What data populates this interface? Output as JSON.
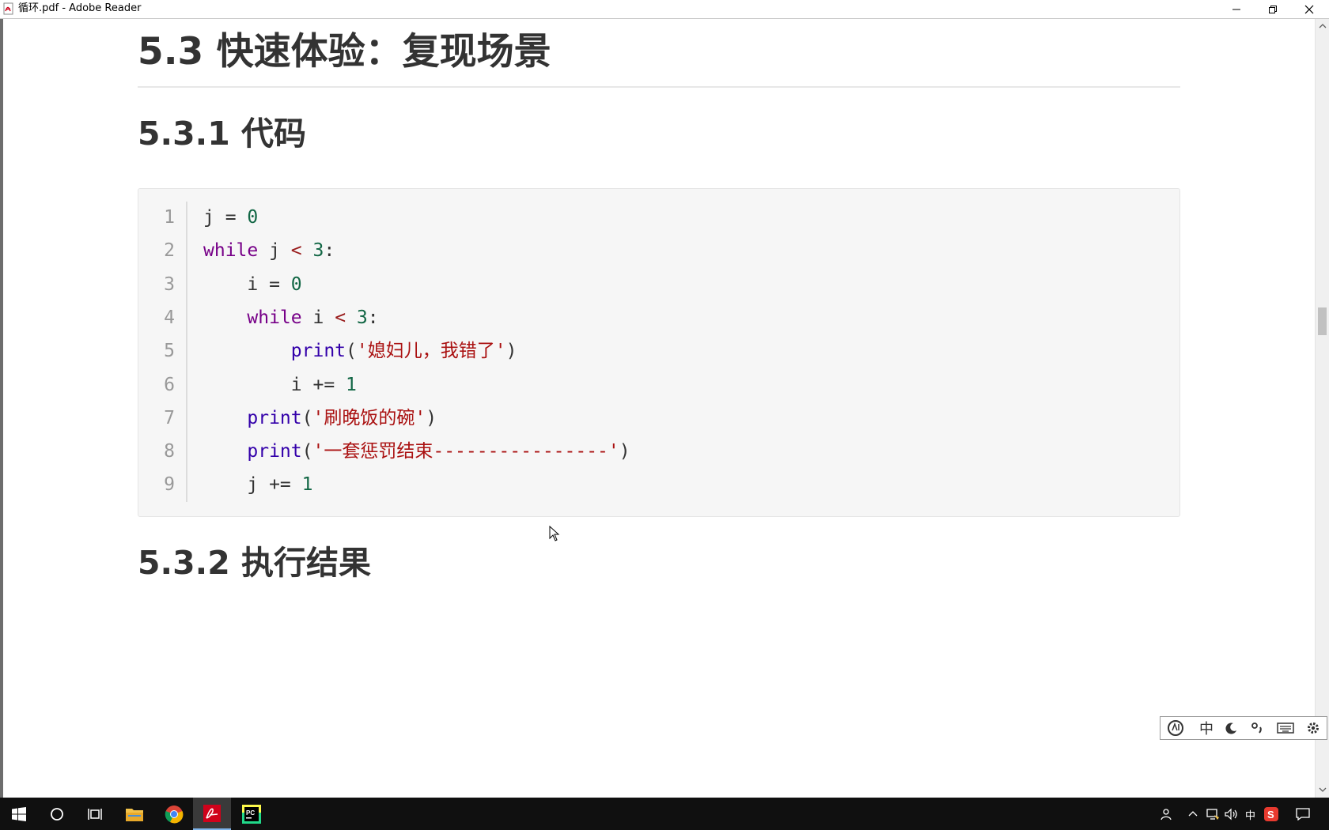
{
  "window": {
    "title": "循环.pdf - Adobe Reader",
    "controls": [
      "minimize-icon",
      "restore-icon",
      "close-icon"
    ]
  },
  "document": {
    "heading_h2": "5.3 快速体验：复现场景",
    "heading_code": "5.3.1 代码",
    "heading_result": "5.3.2 执行结果",
    "code": {
      "line_numbers": [
        "1",
        "2",
        "3",
        "4",
        "5",
        "6",
        "7",
        "8",
        "9"
      ],
      "lines": [
        [
          {
            "t": "j ",
            "c": ""
          },
          {
            "t": "=",
            "c": ""
          },
          {
            "t": " ",
            "c": ""
          },
          {
            "t": "0",
            "c": "num"
          }
        ],
        [
          {
            "t": "while",
            "c": "kw"
          },
          {
            "t": " j ",
            "c": ""
          },
          {
            "t": "<",
            "c": "op"
          },
          {
            "t": " ",
            "c": ""
          },
          {
            "t": "3",
            "c": "num"
          },
          {
            "t": ":",
            "c": ""
          }
        ],
        [
          {
            "t": "    i = ",
            "c": ""
          },
          {
            "t": "0",
            "c": "num"
          }
        ],
        [
          {
            "t": "    ",
            "c": ""
          },
          {
            "t": "while",
            "c": "kw"
          },
          {
            "t": " i ",
            "c": ""
          },
          {
            "t": "<",
            "c": "op"
          },
          {
            "t": " ",
            "c": ""
          },
          {
            "t": "3",
            "c": "num"
          },
          {
            "t": ":",
            "c": ""
          }
        ],
        [
          {
            "t": "        ",
            "c": ""
          },
          {
            "t": "print",
            "c": "bi"
          },
          {
            "t": "(",
            "c": ""
          },
          {
            "t": "'媳妇儿，我错了'",
            "c": "str"
          },
          {
            "t": ")",
            "c": ""
          }
        ],
        [
          {
            "t": "        i += ",
            "c": ""
          },
          {
            "t": "1",
            "c": "num"
          }
        ],
        [
          {
            "t": "    ",
            "c": ""
          },
          {
            "t": "print",
            "c": "bi"
          },
          {
            "t": "(",
            "c": ""
          },
          {
            "t": "'刷晚饭的碗'",
            "c": "str"
          },
          {
            "t": ")",
            "c": ""
          }
        ],
        [
          {
            "t": "    ",
            "c": ""
          },
          {
            "t": "print",
            "c": "bi"
          },
          {
            "t": "(",
            "c": ""
          },
          {
            "t": "'一套惩罚结束----------------'",
            "c": "str"
          },
          {
            "t": ")",
            "c": ""
          }
        ],
        [
          {
            "t": "    j += ",
            "c": ""
          },
          {
            "t": "1",
            "c": "num"
          }
        ]
      ]
    }
  },
  "ime_toolbar": {
    "items": [
      "logo-icon",
      "中",
      "moon-icon",
      "punctuation-icon",
      "keyboard-icon",
      "gear-icon"
    ],
    "mode_label": "中"
  },
  "taskbar": {
    "apps": [
      "start-icon",
      "search-icon",
      "task-view-icon",
      "file-explorer-icon",
      "chrome-icon",
      "adobe-reader-icon",
      "pycharm-icon"
    ],
    "tray_ime": "中",
    "active_app": "adobe-reader-icon"
  },
  "colors": {
    "keyword": "#770088",
    "number": "#116644",
    "string": "#aa1111",
    "builtin": "#3300aa",
    "operator": "#981a1a",
    "code_background": "#f6f6f6"
  }
}
